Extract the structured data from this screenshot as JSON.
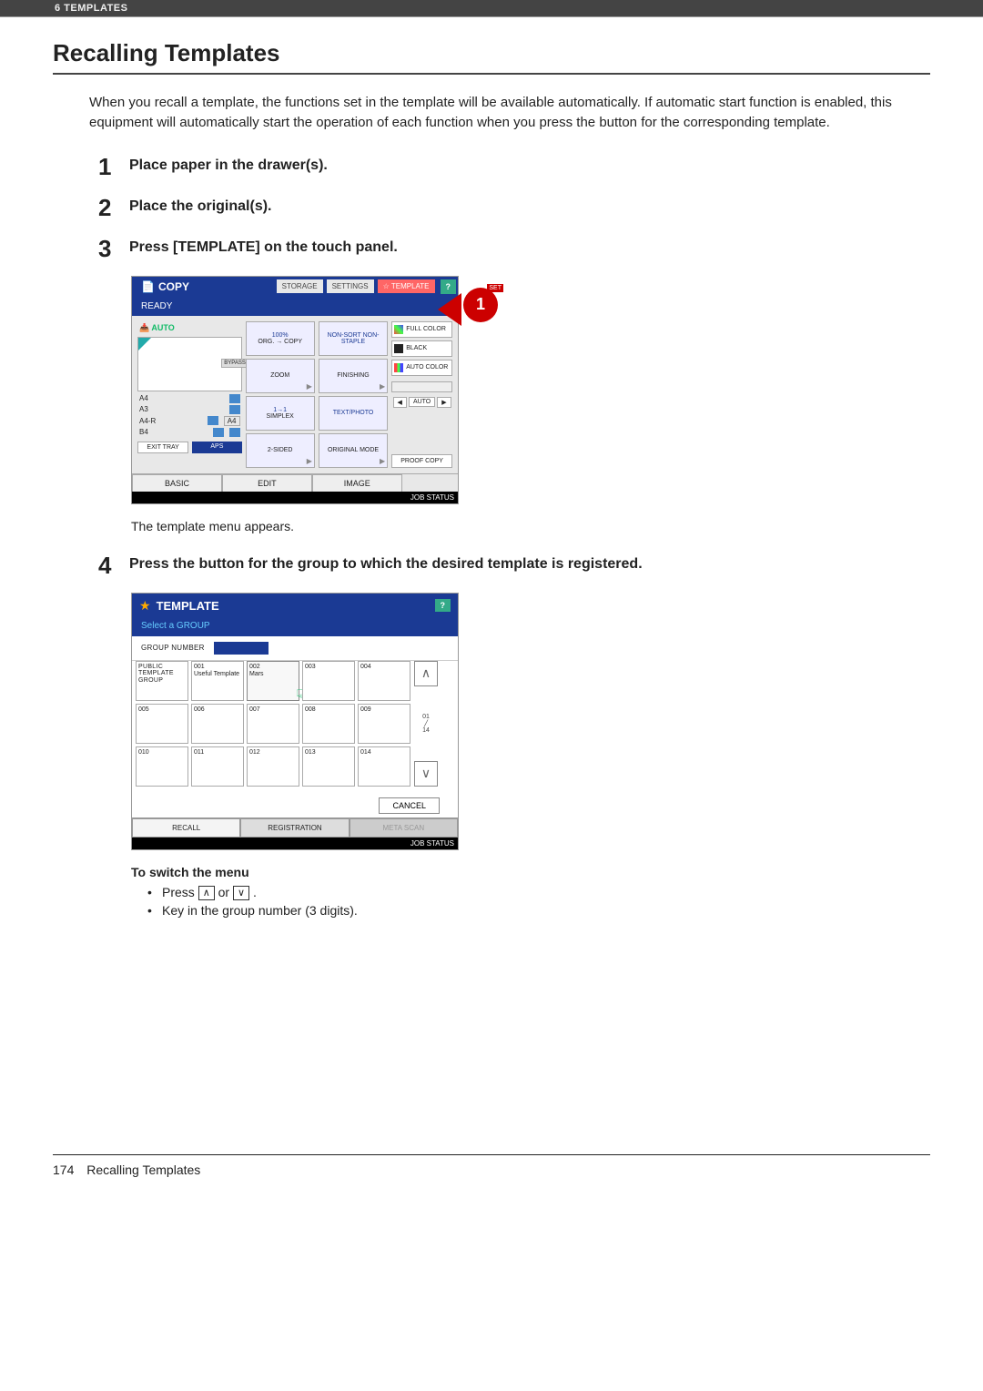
{
  "header": {
    "crumb": "6 TEMPLATES"
  },
  "title": "Recalling Templates",
  "intro": "When you recall a template, the functions set in the template will be available automatically. If automatic start function is enabled, this equipment will automatically start the operation of each function when you press the button for the corresponding template.",
  "steps": {
    "s1": {
      "n": "1",
      "t": "Place paper in the drawer(s)."
    },
    "s2": {
      "n": "2",
      "t": "Place the original(s)."
    },
    "s3": {
      "n": "3",
      "t": "Press [TEMPLATE] on the touch panel."
    },
    "s3_note": "The template menu appears.",
    "s4": {
      "n": "4",
      "t": "Press the button for the group to which the desired template is registered."
    }
  },
  "panel_copy": {
    "copy": "COPY",
    "storage": "STORAGE",
    "settings": "SETTINGS",
    "template": "TEMPLATE",
    "help": "?",
    "ready": "READY",
    "callout_set": "SET",
    "callout_num": "1",
    "auto": "AUTO",
    "bypass": "BYPASS FEED",
    "trays": {
      "a4": "A4",
      "a3": "A3",
      "a4r": "A4-R",
      "b4": "B4",
      "cur": "A4"
    },
    "exit": "EXIT TRAY",
    "aps": "APS",
    "zoom_top": "100%",
    "zoom_sub": "ORG. → COPY",
    "zoom": "ZOOM",
    "simplex_top": "1→1",
    "simplex": "SIMPLEX",
    "twosided": "2-SIDED",
    "finish_top": "NON-SORT NON-STAPLE",
    "finishing": "FINISHING",
    "text_photo": "TEXT/PHOTO",
    "orig_mode": "ORIGINAL MODE",
    "full_color": "FULL COLOR",
    "black": "BLACK",
    "auto_color": "AUTO COLOR",
    "auto_slider": "AUTO",
    "proof": "PROOF COPY",
    "tab_basic": "BASIC",
    "tab_edit": "EDIT",
    "tab_image": "IMAGE",
    "job_status": "JOB STATUS"
  },
  "panel_tpl": {
    "title": "TEMPLATE",
    "sub": "Select a GROUP",
    "help": "?",
    "group_number": "GROUP NUMBER",
    "cells": [
      {
        "id": "public",
        "label": "PUBLIC TEMPLATE GROUP"
      },
      {
        "id": "001",
        "label": "Useful Template"
      },
      {
        "id": "002",
        "label": "Mars"
      },
      {
        "id": "003",
        "label": ""
      },
      {
        "id": "004",
        "label": ""
      },
      {
        "id": "005",
        "label": ""
      },
      {
        "id": "006",
        "label": ""
      },
      {
        "id": "007",
        "label": ""
      },
      {
        "id": "008",
        "label": ""
      },
      {
        "id": "009",
        "label": ""
      },
      {
        "id": "010",
        "label": ""
      },
      {
        "id": "011",
        "label": ""
      },
      {
        "id": "012",
        "label": ""
      },
      {
        "id": "013",
        "label": ""
      },
      {
        "id": "014",
        "label": ""
      }
    ],
    "page_a": "01",
    "page_b": "14",
    "cancel": "CANCEL",
    "tab_recall": "RECALL",
    "tab_reg": "REGISTRATION",
    "tab_meta": "META SCAN",
    "job_status": "JOB STATUS"
  },
  "switch_menu": {
    "h": "To switch the menu",
    "b1a": "Press ",
    "b1b": " or ",
    "b1c": ".",
    "b2": "Key in the group number (3 digits)."
  },
  "footer": {
    "page": "174",
    "title": "Recalling Templates"
  }
}
